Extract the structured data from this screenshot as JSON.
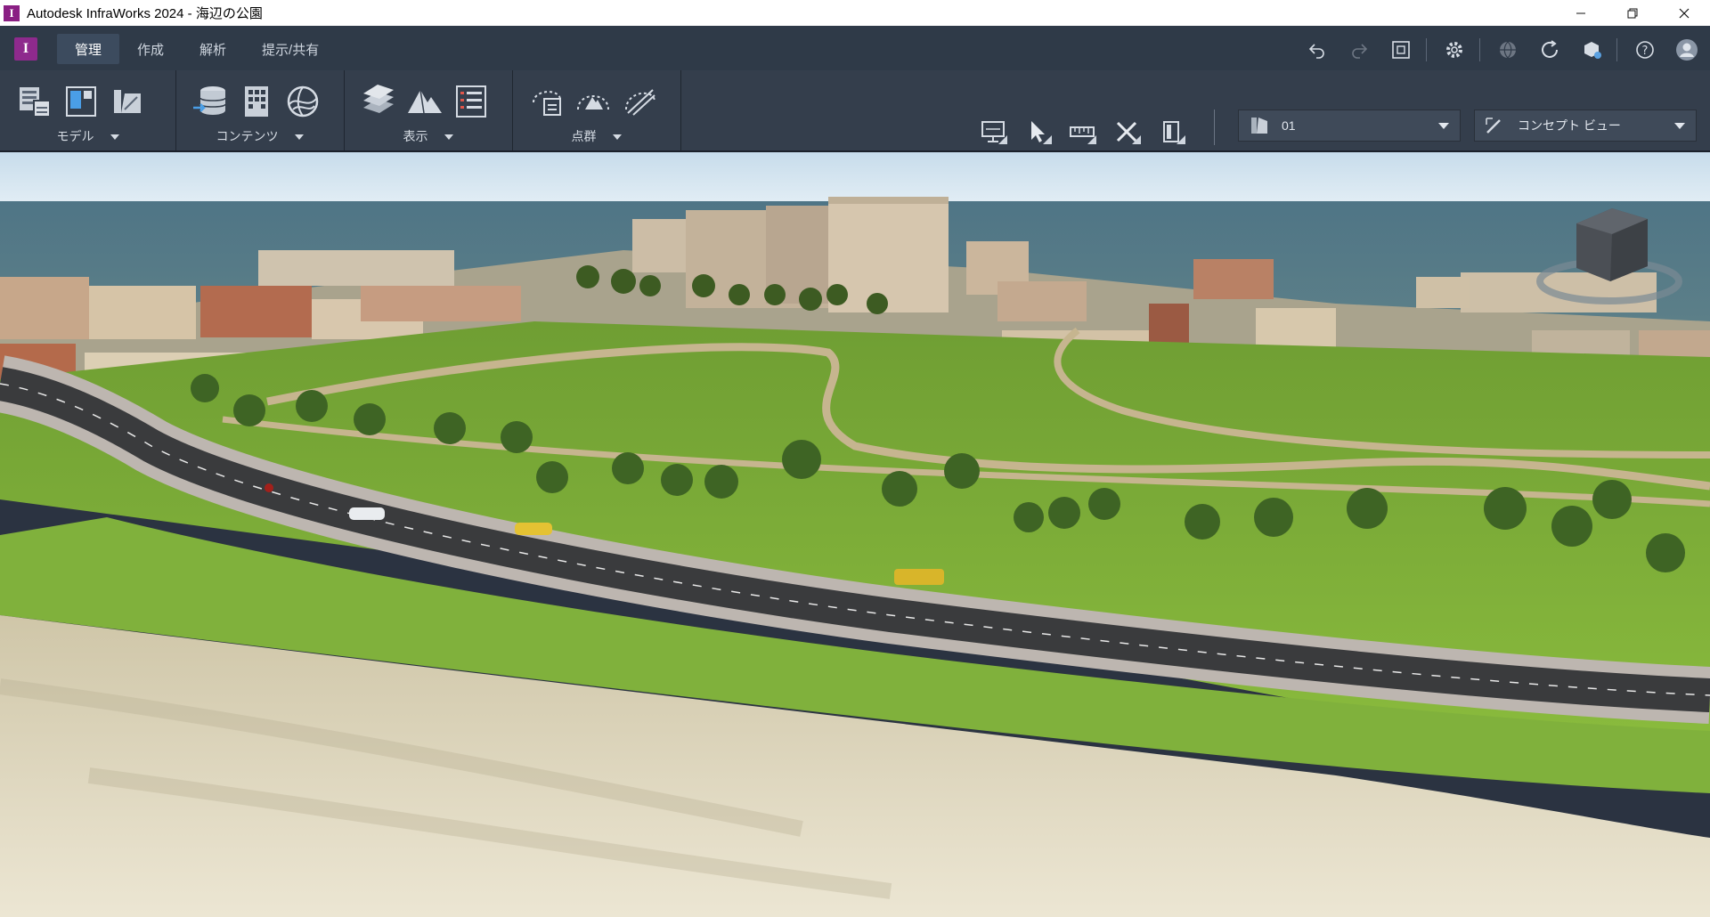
{
  "window": {
    "title": "Autodesk InfraWorks 2024 - 海辺の公園",
    "app_icon_letter": "I",
    "controls": [
      "minimize-icon",
      "restore-icon",
      "close-icon"
    ]
  },
  "tabs": [
    {
      "label": "管理",
      "active": true
    },
    {
      "label": "作成",
      "active": false
    },
    {
      "label": "解析",
      "active": false
    },
    {
      "label": "提示/共有",
      "active": false
    }
  ],
  "top_icons": [
    "undo-icon",
    "redo-icon",
    "fit-view-icon",
    "settings-icon",
    "globe-icon",
    "sync-icon",
    "cloud-model-icon",
    "help-icon",
    "user-icon"
  ],
  "ribbon": {
    "groups": [
      {
        "label": "モデル",
        "icons": [
          "model-table-icon",
          "model-panel-icon",
          "model-surface-icon"
        ]
      },
      {
        "label": "コンテンツ",
        "icons": [
          "data-connect-icon",
          "building-grid-icon",
          "terrain-globe-icon"
        ]
      },
      {
        "label": "表示",
        "icons": [
          "layers-icon",
          "terrain-peak-icon",
          "list-view-icon"
        ]
      },
      {
        "label": "点群",
        "icons": [
          "pointcloud-region-icon",
          "pointcloud-terrain-icon",
          "pointcloud-slice-icon"
        ]
      }
    ],
    "tools": [
      "presentation-icon",
      "select-arrow-icon",
      "measure-icon",
      "cross-tools-icon",
      "panel-toggle-icon"
    ],
    "scenario_dropdown": {
      "value": "01"
    },
    "view_dropdown": {
      "value": "コンセプト ビュー"
    }
  },
  "colors": {
    "titlebar": "#ffffff",
    "tabbar": "#2f3a48",
    "ribbon": "#343e4c",
    "brand": "#8e2a8d",
    "sky": "#cfe4f1",
    "sea": "#5e8394",
    "grass": "#7db43a"
  }
}
